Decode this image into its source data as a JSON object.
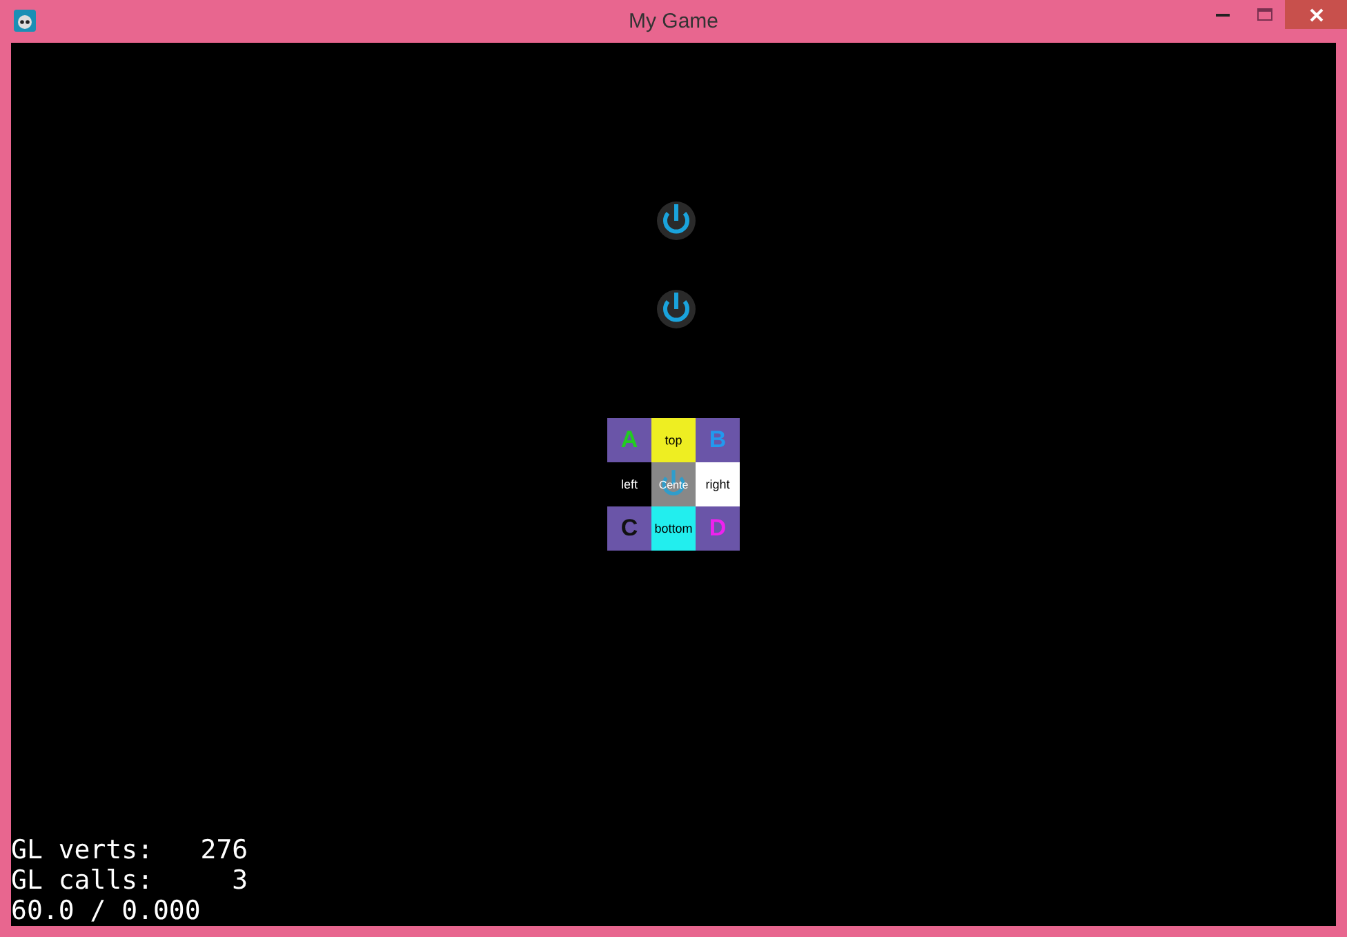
{
  "window": {
    "title": "My Game"
  },
  "buttons": [
    {
      "kind": "power"
    },
    {
      "kind": "power"
    }
  ],
  "grid": [
    {
      "kind": "letter",
      "text": "A",
      "color": "#22cc22"
    },
    {
      "kind": "label",
      "text": "top",
      "color": "#eeee22"
    },
    {
      "kind": "letter",
      "text": "B",
      "color": "#2299ee"
    },
    {
      "kind": "label",
      "text": "left",
      "color": "#000000"
    },
    {
      "kind": "center",
      "text": "Cente",
      "color": "#888888"
    },
    {
      "kind": "label",
      "text": "right",
      "color": "#ffffff"
    },
    {
      "kind": "letter",
      "text": "C",
      "color": "#111111"
    },
    {
      "kind": "label",
      "text": "bottom",
      "color": "#22eeee"
    },
    {
      "kind": "letter",
      "text": "D",
      "color": "#ee22ee"
    }
  ],
  "stats": [
    "GL verts:   276",
    "GL calls:     3",
    "60.0 / 0.000"
  ]
}
